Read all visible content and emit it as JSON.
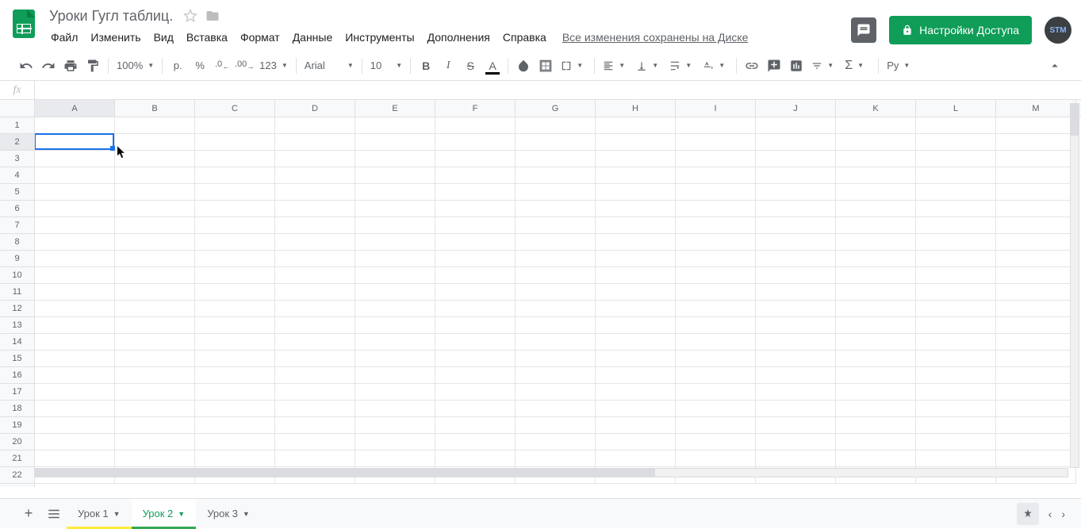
{
  "doc": {
    "title": "Уроки Гугл таблиц."
  },
  "menu": {
    "file": "Файл",
    "edit": "Изменить",
    "view": "Вид",
    "insert": "Вставка",
    "format": "Формат",
    "data": "Данные",
    "tools": "Инструменты",
    "addons": "Дополнения",
    "help": "Справка",
    "save_status": "Все изменения сохранены на Диске"
  },
  "share": {
    "label": "Настройки Доступа"
  },
  "avatar": {
    "initials": "STM"
  },
  "toolbar": {
    "zoom": "100%",
    "currency": "р.",
    "percent": "%",
    "dec_dec": ".0",
    "inc_dec": ".00",
    "more_fmt": "123",
    "font": "Arial",
    "size": "10",
    "lang": "Ру"
  },
  "fx": {
    "label": "fx",
    "value": ""
  },
  "columns": [
    "A",
    "B",
    "C",
    "D",
    "E",
    "F",
    "G",
    "H",
    "I",
    "J",
    "K",
    "L",
    "M"
  ],
  "rows": [
    "1",
    "2",
    "3",
    "4",
    "5",
    "6",
    "7",
    "8",
    "9",
    "10",
    "11",
    "12",
    "13",
    "14",
    "15",
    "16",
    "17",
    "18",
    "19",
    "20",
    "21",
    "22"
  ],
  "selected": {
    "col": 0,
    "row": 1
  },
  "sheets": {
    "tab1": "Урок 1",
    "tab2": "Урок 2",
    "tab3": "Урок 3"
  }
}
